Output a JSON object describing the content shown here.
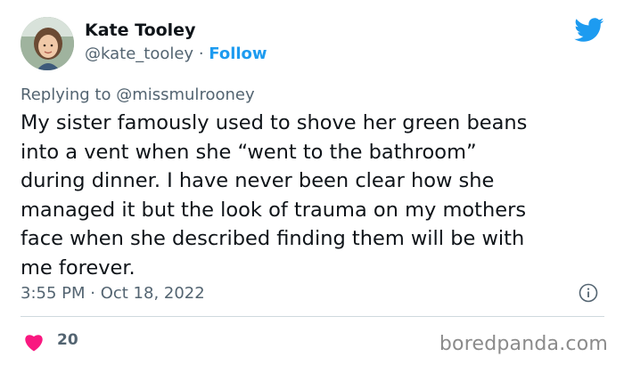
{
  "author": {
    "display_name": "Kate Tooley",
    "handle": "@kate_tooley",
    "separator": " · ",
    "follow_label": "Follow"
  },
  "reply": {
    "prefix": "Replying to ",
    "mention": "@missmulrooney"
  },
  "tweet": {
    "text": "My sister famously used to shove her green beans\ninto a vent when she “went to the bathroom”\nduring dinner. I have never been clear how she\nmanaged it but the look of trauma on my mothers\nface when she described finding them will be with\nme forever.",
    "timestamp": "3:55 PM · Oct 18, 2022"
  },
  "engagement": {
    "likes": "20"
  },
  "watermark": "boredpanda.com",
  "icons": {
    "brand": "twitter-bird-icon",
    "info": "info-icon",
    "like": "heart-icon"
  },
  "colors": {
    "twitter_blue": "#1d9bf0",
    "like_pink": "#f91880",
    "secondary_text": "#536471"
  }
}
